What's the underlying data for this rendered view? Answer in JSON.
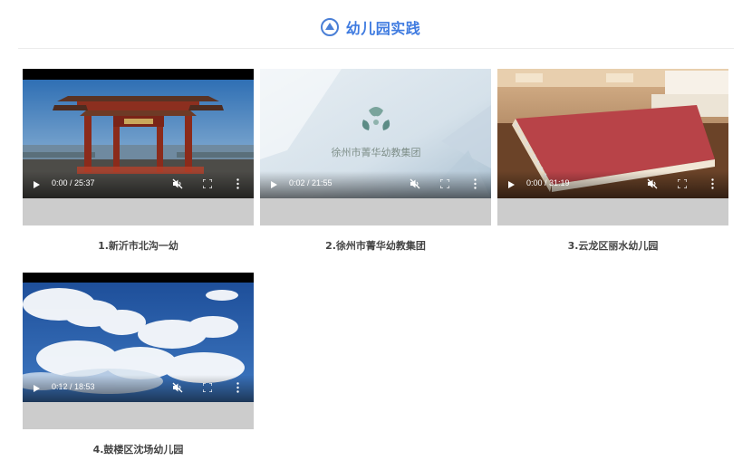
{
  "header": {
    "title": "幼儿园实践",
    "icon": "navigation-arrow-icon",
    "accent_color": "#3f7be0"
  },
  "videos": [
    {
      "time": "0:00 / 25:37",
      "caption": "1.新沂市北沟一幼",
      "scene": "chinese-gate-square"
    },
    {
      "time": "0:02 / 21:55",
      "caption": "2.徐州市菁华幼教集团",
      "scene": "logo-intro",
      "overlay_text": "徐州市菁华幼教集团"
    },
    {
      "time": "0:00 / 31:19",
      "caption": "3.云龙区丽水幼儿园",
      "scene": "red-notebook-library"
    },
    {
      "time": "0:12 / 18:53",
      "caption": "4.鼓楼区沈场幼儿园",
      "scene": "blue-sky-clouds"
    }
  ],
  "icons": {
    "play": "play-icon",
    "mute": "muted-speaker-icon",
    "fullscreen": "fullscreen-icon",
    "more": "more-options-icon"
  }
}
